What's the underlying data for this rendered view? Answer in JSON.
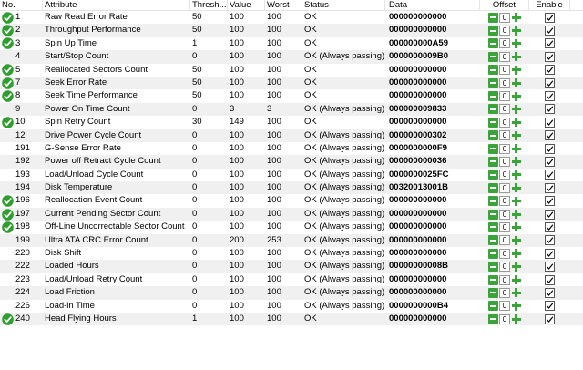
{
  "headers": {
    "no": "No.",
    "attribute": "Attribute",
    "threshold": "Thresh...",
    "value": "Value",
    "worst": "Worst",
    "status": "Status",
    "data": "Data",
    "offset": "Offset",
    "enable": "Enable"
  },
  "colors": {
    "check_green": "#2e9e2e",
    "button_green": "#3aa43a",
    "alt_row": "#f0f0f0"
  },
  "rows": [
    {
      "no": "1",
      "attribute": "Raw Read Error Rate",
      "threshold": "50",
      "value": "100",
      "worst": "100",
      "status": "OK",
      "data": "000000000000",
      "offset": "0",
      "enabled": true,
      "icon": "green-check-icon"
    },
    {
      "no": "2",
      "attribute": "Throughput Performance",
      "threshold": "50",
      "value": "100",
      "worst": "100",
      "status": "OK",
      "data": "000000000000",
      "offset": "0",
      "enabled": true,
      "icon": "green-check-icon"
    },
    {
      "no": "3",
      "attribute": "Spin Up Time",
      "threshold": "1",
      "value": "100",
      "worst": "100",
      "status": "OK",
      "data": "000000000A59",
      "offset": "0",
      "enabled": true,
      "icon": "green-check-icon"
    },
    {
      "no": "4",
      "attribute": "Start/Stop Count",
      "threshold": "0",
      "value": "100",
      "worst": "100",
      "status": "OK (Always passing)",
      "data": "0000000009B0",
      "offset": "0",
      "enabled": true,
      "icon": ""
    },
    {
      "no": "5",
      "attribute": "Reallocated Sectors Count",
      "threshold": "50",
      "value": "100",
      "worst": "100",
      "status": "OK",
      "data": "000000000000",
      "offset": "0",
      "enabled": true,
      "icon": "green-check-icon"
    },
    {
      "no": "7",
      "attribute": "Seek Error Rate",
      "threshold": "50",
      "value": "100",
      "worst": "100",
      "status": "OK",
      "data": "000000000000",
      "offset": "0",
      "enabled": true,
      "icon": "green-check-icon"
    },
    {
      "no": "8",
      "attribute": "Seek Time Performance",
      "threshold": "50",
      "value": "100",
      "worst": "100",
      "status": "OK",
      "data": "000000000000",
      "offset": "0",
      "enabled": true,
      "icon": "green-check-icon"
    },
    {
      "no": "9",
      "attribute": "Power On Time Count",
      "threshold": "0",
      "value": "3",
      "worst": "3",
      "status": "OK (Always passing)",
      "data": "000000009833",
      "offset": "0",
      "enabled": true,
      "icon": ""
    },
    {
      "no": "10",
      "attribute": "Spin Retry Count",
      "threshold": "30",
      "value": "149",
      "worst": "100",
      "status": "OK",
      "data": "000000000000",
      "offset": "0",
      "enabled": true,
      "icon": "green-check-icon"
    },
    {
      "no": "12",
      "attribute": "Drive Power Cycle Count",
      "threshold": "0",
      "value": "100",
      "worst": "100",
      "status": "OK (Always passing)",
      "data": "000000000302",
      "offset": "0",
      "enabled": true,
      "icon": ""
    },
    {
      "no": "191",
      "attribute": "G-Sense Error Rate",
      "threshold": "0",
      "value": "100",
      "worst": "100",
      "status": "OK (Always passing)",
      "data": "0000000000F9",
      "offset": "0",
      "enabled": true,
      "icon": ""
    },
    {
      "no": "192",
      "attribute": "Power off Retract Cycle Count",
      "threshold": "0",
      "value": "100",
      "worst": "100",
      "status": "OK (Always passing)",
      "data": "000000000036",
      "offset": "0",
      "enabled": true,
      "icon": ""
    },
    {
      "no": "193",
      "attribute": "Load/Unload Cycle Count",
      "threshold": "0",
      "value": "100",
      "worst": "100",
      "status": "OK (Always passing)",
      "data": "0000000025FC",
      "offset": "0",
      "enabled": true,
      "icon": ""
    },
    {
      "no": "194",
      "attribute": "Disk Temperature",
      "threshold": "0",
      "value": "100",
      "worst": "100",
      "status": "OK (Always passing)",
      "data": "00320013001B",
      "offset": "0",
      "enabled": true,
      "icon": ""
    },
    {
      "no": "196",
      "attribute": "Reallocation Event Count",
      "threshold": "0",
      "value": "100",
      "worst": "100",
      "status": "OK (Always passing)",
      "data": "000000000000",
      "offset": "0",
      "enabled": true,
      "icon": "green-check-icon"
    },
    {
      "no": "197",
      "attribute": "Current Pending Sector Count",
      "threshold": "0",
      "value": "100",
      "worst": "100",
      "status": "OK (Always passing)",
      "data": "000000000000",
      "offset": "0",
      "enabled": true,
      "icon": "green-check-icon"
    },
    {
      "no": "198",
      "attribute": "Off-Line Uncorrectable Sector Count",
      "threshold": "0",
      "value": "100",
      "worst": "100",
      "status": "OK (Always passing)",
      "data": "000000000000",
      "offset": "0",
      "enabled": true,
      "icon": "green-check-icon"
    },
    {
      "no": "199",
      "attribute": "Ultra ATA CRC Error Count",
      "threshold": "0",
      "value": "200",
      "worst": "253",
      "status": "OK (Always passing)",
      "data": "000000000000",
      "offset": "0",
      "enabled": true,
      "icon": ""
    },
    {
      "no": "220",
      "attribute": "Disk Shift",
      "threshold": "0",
      "value": "100",
      "worst": "100",
      "status": "OK (Always passing)",
      "data": "000000000000",
      "offset": "0",
      "enabled": true,
      "icon": ""
    },
    {
      "no": "222",
      "attribute": "Loaded Hours",
      "threshold": "0",
      "value": "100",
      "worst": "100",
      "status": "OK (Always passing)",
      "data": "00000000008B",
      "offset": "0",
      "enabled": true,
      "icon": ""
    },
    {
      "no": "223",
      "attribute": "Load/Unload Retry Count",
      "threshold": "0",
      "value": "100",
      "worst": "100",
      "status": "OK (Always passing)",
      "data": "000000000000",
      "offset": "0",
      "enabled": true,
      "icon": ""
    },
    {
      "no": "224",
      "attribute": "Load Friction",
      "threshold": "0",
      "value": "100",
      "worst": "100",
      "status": "OK (Always passing)",
      "data": "000000000000",
      "offset": "0",
      "enabled": true,
      "icon": ""
    },
    {
      "no": "226",
      "attribute": "Load-in Time",
      "threshold": "0",
      "value": "100",
      "worst": "100",
      "status": "OK (Always passing)",
      "data": "0000000000B4",
      "offset": "0",
      "enabled": true,
      "icon": ""
    },
    {
      "no": "240",
      "attribute": "Head Flying Hours",
      "threshold": "1",
      "value": "100",
      "worst": "100",
      "status": "OK",
      "data": "000000000000",
      "offset": "0",
      "enabled": true,
      "icon": "green-check-icon"
    }
  ]
}
